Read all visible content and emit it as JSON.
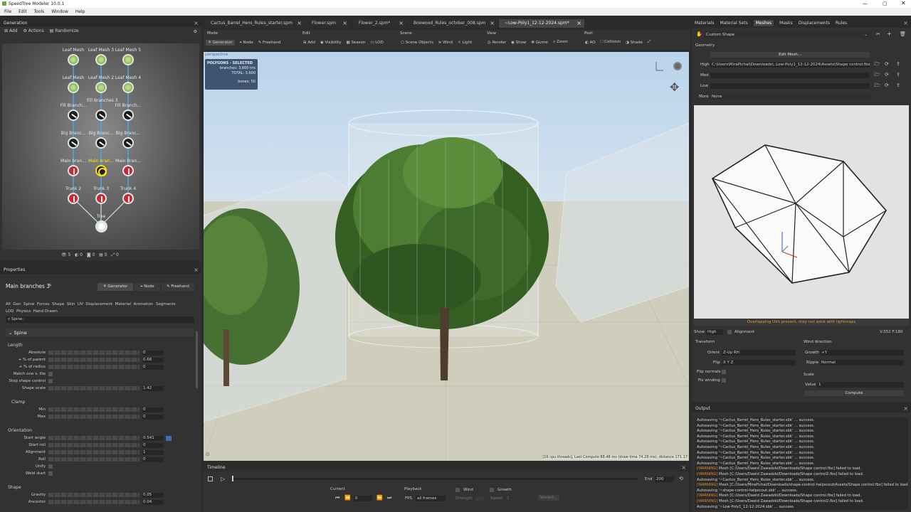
{
  "app": {
    "title": "SpeedTree  Modeler 10.0.1"
  },
  "menu": [
    "File",
    "Edit",
    "Tools",
    "Window",
    "Help"
  ],
  "generation": {
    "title": "Generation",
    "toolbar": {
      "add": "Add",
      "actions": "Actions",
      "randomize": "Randomize"
    },
    "nodes": {
      "leaf_mesh": "Leaf Mesh",
      "leaf_mesh3": "Leaf Mesh 3",
      "leaf_mesh5": "Leaf Mesh 5",
      "leaf_mesh_b": "Leaf Mesh",
      "leaf_mesh2": "Leaf Mesh 2",
      "leaf_mesh4": "Leaf Mesh 4",
      "fill_a": "Fill Branch...",
      "fill3": "Fill Branches 3",
      "fill_c": "Fill Branch...",
      "big_a": "Big Branc...",
      "big_b": "Big Branc...",
      "big_c": "Big Branc...",
      "main_a": "Main bran...",
      "main_b": "Main bran...",
      "main_c": "Main bran...",
      "trunk2": "Trunk 2",
      "trunk3": "Trunk 3",
      "trunk4": "Trunk 4",
      "tree": "Tree"
    },
    "footer": [
      "5",
      "0",
      "0",
      "0",
      "0"
    ]
  },
  "properties": {
    "title": "Properties",
    "node_name": "Main branches 3",
    "modes": [
      "Generator",
      "Node",
      "Freehand"
    ],
    "tabs": [
      "All",
      "Gen",
      "Spine",
      "Forces",
      "Shape",
      "Skin",
      "UV",
      "Displacement",
      "Material",
      "Animation",
      "Segments",
      "LOD",
      "Physics",
      "Hand Drawn"
    ],
    "search": "Spine:",
    "section": "Spine",
    "length": "Length",
    "rows": {
      "absolute": {
        "label": "Absolute",
        "value": "0"
      },
      "pct_parent": {
        "label": "+ % of parent",
        "value": "0.66"
      },
      "pct_radius": {
        "label": "+ % of radius",
        "value": "0"
      },
      "match_one": {
        "label": "Match one v. lite"
      },
      "stop_shape": {
        "label": "Stop shape control"
      },
      "shape_scale": {
        "label": "Shape scale",
        "value": "1.42"
      }
    },
    "clamp": "Clamp",
    "min": {
      "label": "Min",
      "value": "0"
    },
    "max": {
      "label": "Max",
      "value": "0"
    },
    "orientation": "Orientation",
    "start_angle": {
      "label": "Start angle",
      "value": "0.541"
    },
    "start_roll": {
      "label": "Start roll",
      "value": "0"
    },
    "alignment": {
      "label": "Alignment",
      "value": "1"
    },
    "roll": {
      "label": "Roll",
      "value": "0"
    },
    "unify": {
      "label": "Unify"
    },
    "weld_start": {
      "label": "Weld start"
    },
    "shape": "Shape",
    "gravity": {
      "label": "Gravity",
      "value": "0.05"
    },
    "ancestor": {
      "label": "Ancestor",
      "value": "0.04"
    }
  },
  "tabs": [
    "Cactus_Barrel_Hero_Rules_starter.spm",
    "Flower.spm",
    "Flower_2.spm*",
    "Boxwood_Rules_october_008.spm",
    "~Low-Poly1_12-12-2024.spm*"
  ],
  "toolbar": {
    "mode": "Mode",
    "edit": "Edit",
    "scene": "Scene",
    "view": "View",
    "post": "Post",
    "generator": "Generator",
    "node": "Node",
    "freehand": "Freehand",
    "add": "Add",
    "visibility": "Visibility",
    "season": "Season",
    "lod": "LOD",
    "scene_objects": "Scene Objects",
    "wind": "Wind",
    "light": "Light",
    "render": "Render",
    "show": "Show",
    "gizmo": "Gizmo",
    "zoom": "Zoom",
    "ao": "AO",
    "collision": "Collision",
    "shade": "Shade"
  },
  "viewport": {
    "label": "perspective",
    "poly_title": "POLYGONS - SELECTED",
    "branches": "branches: 3,600 tris",
    "total": "TOTAL: 3,600",
    "bones": "bones: 50",
    "status": "[16 cpu threads], Last Compute 88.48 ms (draw time 74.28 ms), distance 171.17"
  },
  "timeline": {
    "title": "Timeline",
    "end_label": "End",
    "end_value": "200",
    "current": "Current",
    "current_value": "0",
    "playback": "Playback",
    "fps": "FPS",
    "fps_value": "all frames",
    "wind": "Wind",
    "strength": "Strength",
    "growth": "Growth",
    "speed": "Speed",
    "speed_value": "1",
    "wizard": "Wizard..."
  },
  "right_tabs": [
    "Materials",
    "Material Sets",
    "Meshes",
    "Masks",
    "Displacements",
    "Rules"
  ],
  "mesh": {
    "name": "Custom Shape",
    "geometry": "Geometry",
    "edit_mesh": "Edit Mesh...",
    "high": "High",
    "high_path": "C:\\Users\\MiraPichal\\Downloads\\..Low-Poly1_12-12-2024\\Assets\\Shape control.fbx",
    "med": "Med",
    "low": "Low",
    "more": "More",
    "more_value": "None",
    "warning": "Overlapping UVs present, may not work with lightmaps",
    "show": "Show",
    "show_value": "High",
    "alignment": "Alignment",
    "verts": "V:352  F:180",
    "transform": "Transform",
    "orient": "Orient",
    "orient_value": "Z-Up RH",
    "flip": "Flip",
    "flip_value": "X Y Z",
    "flip_normals": "Flip normals",
    "fix_winding": "Fix winding",
    "wind_direction": "Wind direction",
    "growth": "Growth",
    "growth_value": "+Y",
    "ripple": "Ripple",
    "ripple_value": "Normal",
    "scale": "Scale",
    "value": "Value",
    "value_value": "1",
    "compute": "Compute"
  },
  "output": {
    "title": "Output",
    "lines": [
      {
        "t": "Autosaving '~Cactus_Barrel_Hero_Rules_starter.sbk' ... success.",
        "w": false
      },
      {
        "t": "Autosaving '~Cactus_Barrel_Hero_Rules_starter.sbk' ... success.",
        "w": false
      },
      {
        "t": "Autosaving '~Cactus_Barrel_Hero_Rules_starter.sbk' ... success.",
        "w": false
      },
      {
        "t": "Autosaving '~Cactus_Barrel_Hero_Rules_starter.sbk' ... success.",
        "w": false
      },
      {
        "t": "Autosaving '~Cactus_Barrel_Hero_Rules_starter.sbk' ... success.",
        "w": false
      },
      {
        "t": "Autosaving '~Cactus_Barrel_Hero_Rules_starter.sbk' ... success.",
        "w": false
      },
      {
        "t": "Autosaving '~Cactus_Barrel_Hero_Rules_starter.sbk' ... success.",
        "w": false
      },
      {
        "t": "Autosaving '~Cactus_Barrel_Hero_Rules_starter.sbk' ... success.",
        "w": false
      },
      {
        "t": "Autosaving '~Cactus_Barrel_Hero_Rules_starter.sbk' ... success.",
        "w": false
      },
      {
        "t": "[WARNING] Mesh [C:/Users/Dawid Zawadzki/Downloads/Shape control.fbx] failed to load.",
        "w": true
      },
      {
        "t": "[WARNING] Mesh [C:/Users/Dawid Zawadzki/Downloads/Shape control2.fbx] failed to load.",
        "w": true
      },
      {
        "t": "Autosaving '~Cactus_Barrel_Hero_Rules_starter.sbk' ... success.",
        "w": false
      },
      {
        "t": "[WARNING] Mesh [C:/Users/MiraPichal/Downloads/shape-control-helpscout/Assets/Shape control.fbx] failed to load.",
        "w": true
      },
      {
        "t": "Autosaving '~shape-control-helpscout.sbk' ... success.",
        "w": false
      },
      {
        "t": "[WARNING] Mesh [C:/Users/Dawid Zawadzki/Downloads/Shape control.fbx] failed to load.",
        "w": true
      },
      {
        "t": "[WARNING] Mesh [C:/Users/Dawid Zawadzki/Downloads/Shape control2.fbx] failed to load.",
        "w": true
      },
      {
        "t": "Autosaving '~Low-Poly1_12-12-2024.sbk' ... success.",
        "w": false
      }
    ]
  }
}
